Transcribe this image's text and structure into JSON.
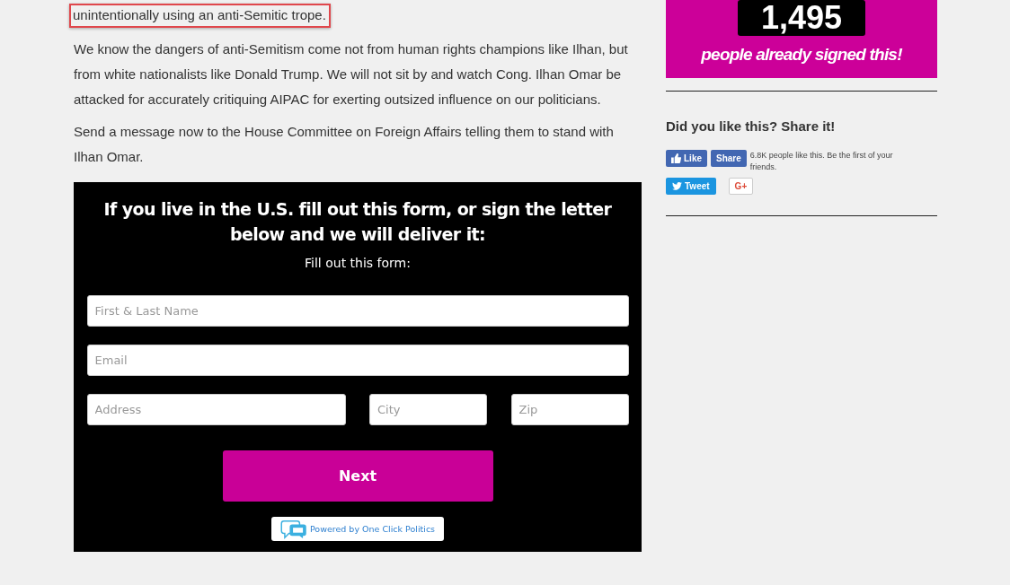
{
  "article": {
    "highlighted_line": "unintentionally using an anti-Semitic trope.",
    "paragraphs": [
      "We know the dangers of anti-Semitism come not from human rights champions like Ilhan, but from white nationalists like Donald Trump. We will not sit by and watch Cong. Ilhan Omar be attacked for accurately critiquing AIPAC for exerting outsized influence on our politicians.",
      "Send a message now to the House Committee on Foreign Affairs telling them to stand with Ilhan Omar."
    ]
  },
  "form": {
    "title": "If you live in the U.S. fill out this form, or sign the letter below and we will deliver it:",
    "subtitle": "Fill out this form:",
    "fields": [
      {
        "placeholder": "First & Last Name",
        "kind": "full"
      },
      {
        "placeholder": "Email",
        "kind": "full"
      },
      {
        "placeholder": "Address",
        "kind": "address"
      },
      {
        "placeholder": "City",
        "kind": "city"
      },
      {
        "placeholder": "Zip",
        "kind": "zip"
      }
    ],
    "submit": "Next",
    "powered_by": "Powered by One Click Politics"
  },
  "sidebar": {
    "counter": "1,495",
    "counter_caption": "people already signed this!",
    "share_heading": "Did you like this? Share it!",
    "like_button": "Like",
    "share_button": "Share",
    "like_text": "6.8K people like this. Be the first of your friends.",
    "tweet_button": "Tweet",
    "gplus_button": "G+"
  }
}
